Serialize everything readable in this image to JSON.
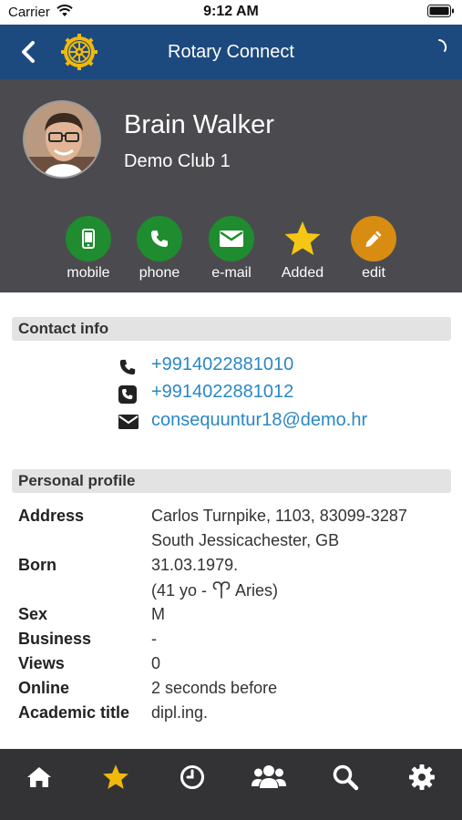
{
  "status_bar": {
    "carrier": "Carrier",
    "time": "9:12 AM"
  },
  "nav": {
    "title": "Rotary Connect"
  },
  "profile": {
    "name": "Brain Walker",
    "club": "Demo Club 1"
  },
  "actions": [
    {
      "label": "mobile",
      "icon": "mobile-icon",
      "color": "#1e8c2f"
    },
    {
      "label": "phone",
      "icon": "phone-icon",
      "color": "#1e8c2f"
    },
    {
      "label": "e-mail",
      "icon": "email-icon",
      "color": "#1e8c2f"
    },
    {
      "label": "Added",
      "icon": "star-icon",
      "color": "#f6c614"
    },
    {
      "label": "edit",
      "icon": "pencil-icon",
      "color": "#d98c12"
    }
  ],
  "contact_info": {
    "title": "Contact info",
    "items": [
      {
        "icon": "phone-icon",
        "value": "+9914022881010"
      },
      {
        "icon": "phone-square-icon",
        "value": "+9914022881012"
      },
      {
        "icon": "envelope-icon",
        "value": "consequuntur18@demo.hr"
      }
    ]
  },
  "personal_profile": {
    "title": "Personal profile",
    "address_label": "Address",
    "address_line1": "Carlos Turnpike, 1103, 83099-3287",
    "address_line2": "South Jessicachester, GB",
    "born_label": "Born",
    "born_date": "31.03.1979.",
    "born_age_prefix": "(41 yo - ",
    "born_age_suffix": " Aries)",
    "sex_label": "Sex",
    "sex_value": "M",
    "business_label": "Business",
    "business_value": "-",
    "views_label": "Views",
    "views_value": "0",
    "online_label": "Online",
    "online_value": "2 seconds before",
    "academic_label": "Academic title",
    "academic_value": "dipl.ing."
  },
  "tab_bar": {
    "tabs": [
      "home-icon",
      "star-icon",
      "clock-icon",
      "users-icon",
      "search-icon",
      "gear-icon"
    ],
    "active_index": 1,
    "active_color": "#f0b90b"
  }
}
